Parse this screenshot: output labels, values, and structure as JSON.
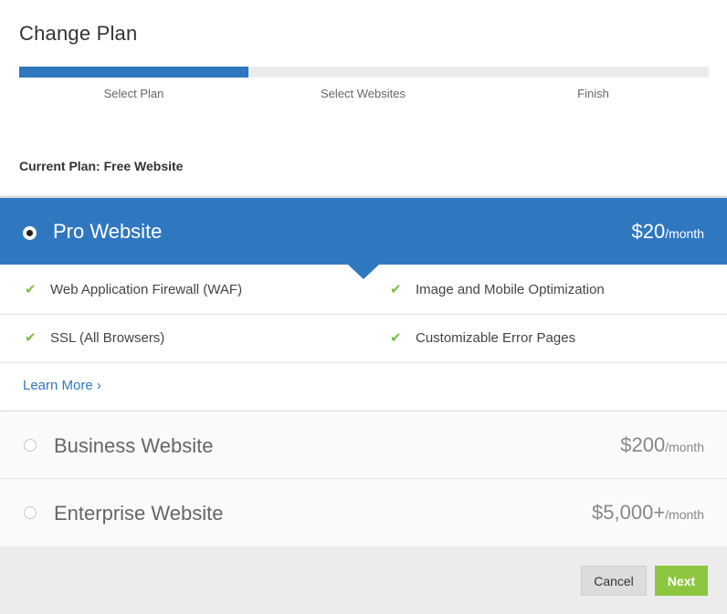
{
  "dialog": {
    "title": "Change Plan"
  },
  "progress": {
    "fraction": 0.333,
    "steps": [
      "Select Plan",
      "Select Websites",
      "Finish"
    ]
  },
  "current_plan_label": "Current Plan: Free Website",
  "plans": [
    {
      "name": "Pro Website",
      "price": "$20",
      "per": "/month",
      "selected": true,
      "features": [
        "Web Application Firewall (WAF)",
        "Image and Mobile Optimization",
        "SSL (All Browsers)",
        "Customizable Error Pages"
      ],
      "learn_more": "Learn More ›"
    },
    {
      "name": "Business Website",
      "price": "$200",
      "per": "/month",
      "selected": false
    },
    {
      "name": "Enterprise Website",
      "price": "$5,000+",
      "per": "/month",
      "selected": false
    }
  ],
  "footer": {
    "cancel_label": "Cancel",
    "next_label": "Next"
  },
  "icons": {
    "feature": "check-icon"
  },
  "colors": {
    "accent": "#2f78c0",
    "success": "#8cc63f",
    "check": "#7cc142"
  }
}
